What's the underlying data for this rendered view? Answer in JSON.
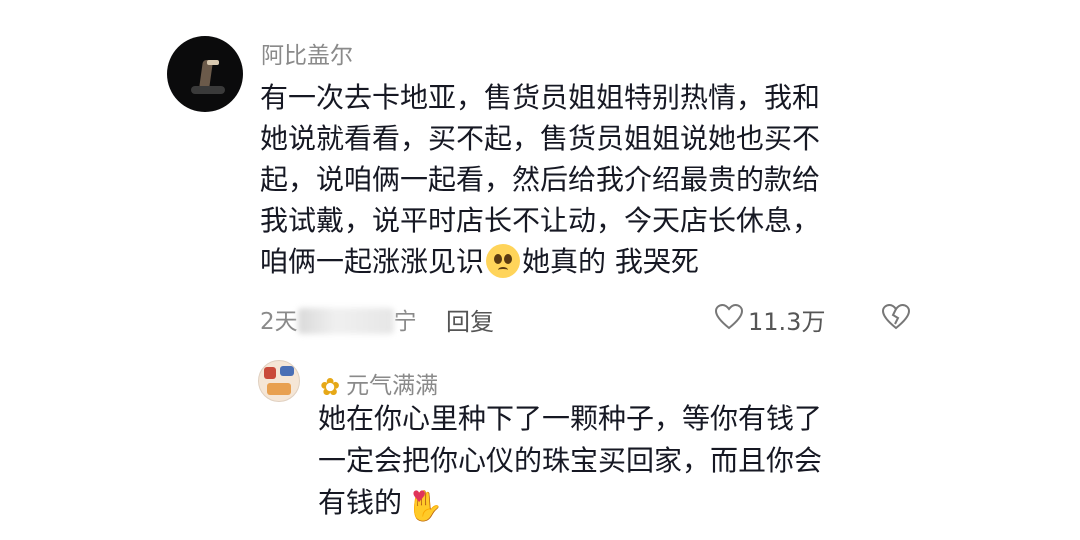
{
  "comment": {
    "username": "阿比盖尔",
    "lines": [
      "有一次去卡地亚，售货员姐姐特别热情，我和",
      "她说就看看，买不起，售货员姐姐说她也买不",
      "起，说咱俩一起看，然后给我介绍最贵的款给",
      "我试戴，说平时店长不让动，今天店长休息，"
    ],
    "last_line_before_emoji": "咱俩一起涨涨见识",
    "last_line_after_emoji": "她真的 我哭死",
    "time_prefix": "2天",
    "time_suffix": "宁",
    "reply_label": "回复",
    "like_count": "11.3万",
    "like_icon": "heart-outline-icon",
    "dislike_icon": "broken-heart-icon"
  },
  "reply": {
    "username": "元气满满",
    "username_emoji": "sunflower-icon",
    "lines": [
      "她在你心里种下了一颗种子，等你有钱了",
      "一定会把你心仪的珠宝买回家，而且你会"
    ],
    "last_line": "有钱的",
    "end_emoji": "hand-heart-icon"
  }
}
